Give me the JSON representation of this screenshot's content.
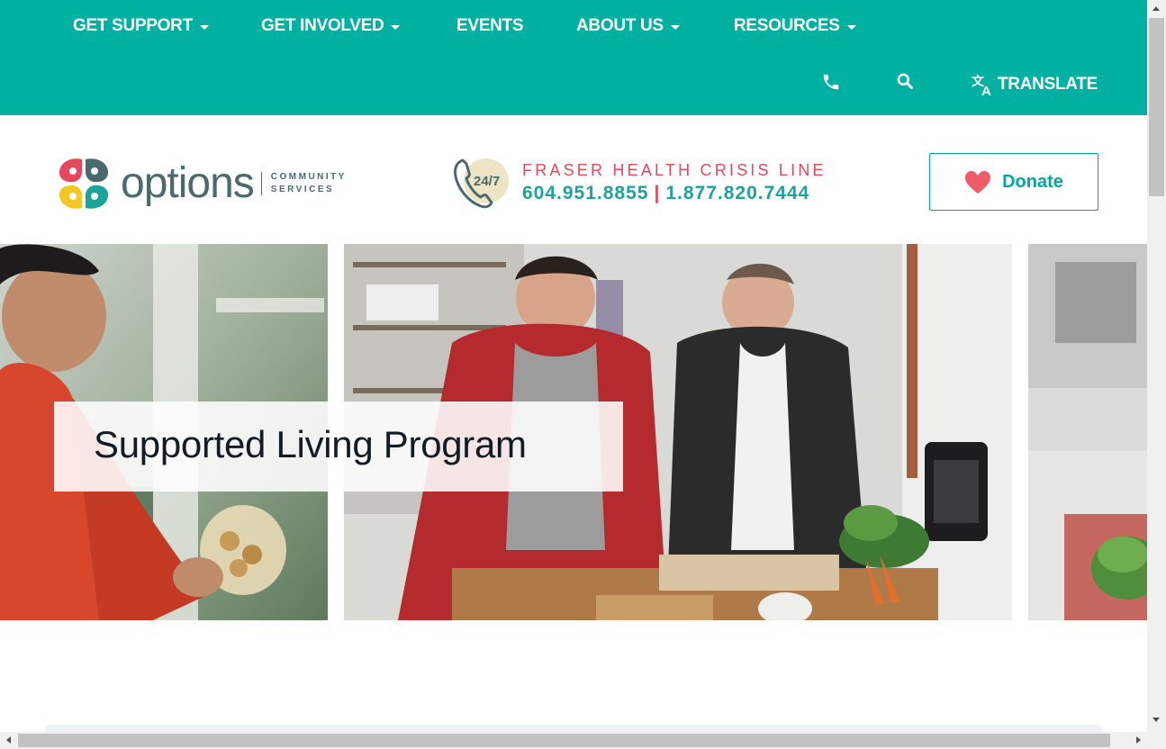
{
  "nav": {
    "items": [
      {
        "label": "GET SUPPORT",
        "dropdown": true
      },
      {
        "label": "GET INVOLVED",
        "dropdown": true
      },
      {
        "label": "EVENTS",
        "dropdown": false
      },
      {
        "label": "ABOUT US",
        "dropdown": true
      },
      {
        "label": "RESOURCES",
        "dropdown": true
      }
    ],
    "translate_label": "TRANSLATE",
    "icons": [
      "phone-icon",
      "search-icon",
      "translate-icon"
    ]
  },
  "header": {
    "logo": {
      "word": "options",
      "sub_line1": "COMMUNITY",
      "sub_line2": "SERVICES"
    },
    "crisis": {
      "badge": "24/7",
      "title": "FRASER HEALTH CRISIS LINE",
      "phone1": "604.951.8855",
      "separator": "|",
      "phone2": "1.877.820.7444"
    },
    "donate_label": "Donate"
  },
  "hero": {
    "title": "Supported Living Program"
  },
  "colors": {
    "brand": "#00b0a0",
    "accent": "#e8485a",
    "teal_text": "#1aa598",
    "logo_text": "#4a6a6e"
  }
}
